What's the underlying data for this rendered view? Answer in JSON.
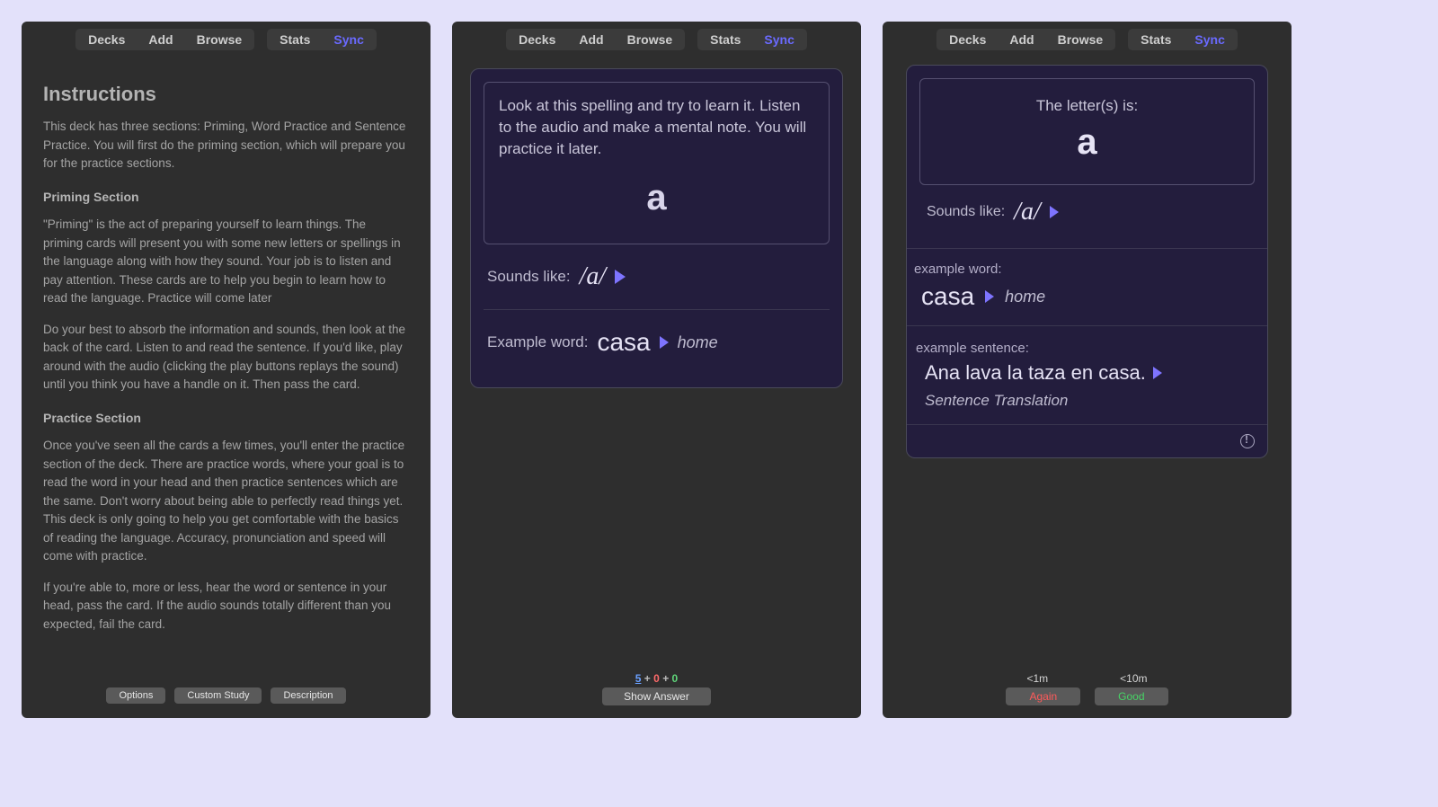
{
  "nav": {
    "decks": "Decks",
    "add": "Add",
    "browse": "Browse",
    "stats": "Stats",
    "sync": "Sync"
  },
  "screen1": {
    "title": "Instructions",
    "p1": "This deck has three sections: Priming, Word Practice and Sentence Practice. You will first do the priming section, which will prepare you for the practice sections.",
    "h1": "Priming Section",
    "p2": "\"Priming\" is the act of preparing yourself to learn things. The priming cards will present you with some new letters or spellings in the language along with how they sound. Your job is to listen and pay attention. These cards are to help you begin to learn how to read the language. Practice will come later",
    "p3": "Do your best to absorb the information and sounds, then look at the back of the card. Listen to and read the sentence. If you'd like, play around with the audio (clicking the play buttons replays the sound) until you think you have a handle on it. Then pass the card.",
    "h2": "Practice Section",
    "p4": "Once you've seen all the cards a few times, you'll enter the practice section of the deck. There are practice words, where your goal is to read the word in your head and then practice sentences which are the same. Don't worry about being able to perfectly read things yet. This deck is only going to help you get comfortable with the basics of reading the language. Accuracy, pronunciation and speed will come with practice.",
    "p5": "If you're able to, more or less, hear the word or sentence in your head, pass the card. If the audio sounds totally different than you expected, fail the card.",
    "buttons": {
      "options": "Options",
      "custom_study": "Custom Study",
      "description": "Description"
    }
  },
  "screen2": {
    "prompt": "Look at this spelling and try to learn it. Listen to the audio and make a mental note. You will practice it later.",
    "letter": "a",
    "sounds_label": "Sounds like:",
    "ipa": "/a/",
    "example_label": "Example word:",
    "example_word": "casa",
    "example_trans": "home",
    "counts": {
      "new": "5",
      "learn": "0",
      "review": "0",
      "plus": "+"
    },
    "show_answer": "Show Answer"
  },
  "screen3": {
    "head": "The letter(s) is:",
    "letter": "a",
    "sounds_label": "Sounds like:",
    "ipa": "/a/",
    "ex_word_label": "example word:",
    "ex_word": "casa",
    "ex_trans": "home",
    "ex_sent_label": "example sentence:",
    "sentence": "Ana lava la taza en casa.",
    "sentence_trans": "Sentence Translation",
    "timing": {
      "again": "<1m",
      "good": "<10m"
    },
    "rate": {
      "again": "Again",
      "good": "Good"
    }
  }
}
